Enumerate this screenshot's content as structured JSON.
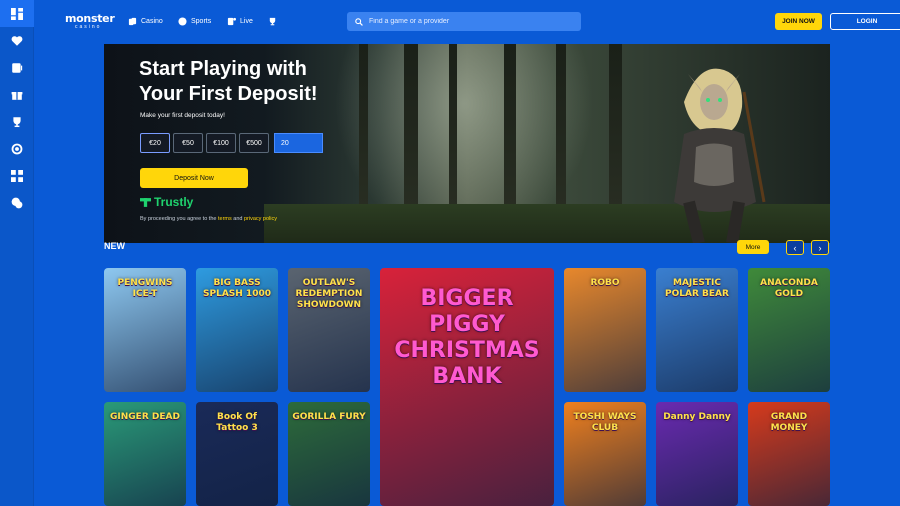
{
  "brand": {
    "logo_main": "monster",
    "logo_sub": "casino"
  },
  "nav": [
    {
      "label": "Casino",
      "icon": "cards-icon"
    },
    {
      "label": "Sports",
      "icon": "ball-icon"
    },
    {
      "label": "Live",
      "icon": "live-cards-icon"
    },
    {
      "label": "",
      "icon": "trophy-icon"
    }
  ],
  "search": {
    "placeholder": "Find a game or a provider",
    "value": ""
  },
  "auth": {
    "join": "JOIN NOW",
    "login": "LOGIN"
  },
  "sidebar": [
    {
      "icon": "dashboard-icon",
      "active": true
    },
    {
      "icon": "heart-icon"
    },
    {
      "icon": "slot-machine-icon"
    },
    {
      "icon": "gift-icon"
    },
    {
      "icon": "trophy-icon"
    },
    {
      "icon": "target-icon"
    },
    {
      "icon": "grid-icon"
    },
    {
      "icon": "chat-icon"
    }
  ],
  "hero": {
    "title_line1": "Start Playing with",
    "title_line2": "Your First Deposit!",
    "subtitle": "Make your first deposit today!",
    "amounts": [
      "€20",
      "€50",
      "€100",
      "€500"
    ],
    "amount_value": "20",
    "deposit_button": "Deposit Now",
    "trustly": "Trustly",
    "legal_prefix": "By proceeding you agree to the",
    "legal_terms": "terms",
    "legal_and": "and",
    "legal_privacy": "privacy policy"
  },
  "games_section": {
    "title": "NEW",
    "more": "More",
    "prev": "‹",
    "next": "›"
  },
  "games": [
    {
      "title": "PENGWINS ICE-T",
      "bg": "#8ec8f0"
    },
    {
      "title": "BIG BASS SPLASH 1000",
      "bg": "#2e9be0"
    },
    {
      "title": "OUTLAW'S REDEMPTION SHOWDOWN",
      "bg": "#5a6470"
    },
    {
      "title": "BIGGER PIGGY CHRISTMAS BANK",
      "bg": "#d8223a"
    },
    {
      "title": "ROBO",
      "bg": "#e8882c"
    },
    {
      "title": "MAJESTIC POLAR BEAR",
      "bg": "#3a7fd0"
    },
    {
      "title": "ANACONDA GOLD",
      "bg": "#3f8a3a"
    },
    {
      "title": "GINGER DEAD",
      "bg": "#2a9a78"
    },
    {
      "title": "Book Of Tattoo 3",
      "bg": "#1a2a58"
    },
    {
      "title": "GORILLA FURY",
      "bg": "#2d6b3a"
    },
    {
      "title": "TOSHI WAYS CLUB",
      "bg": "#f0801e"
    },
    {
      "title": "Danny Danny",
      "bg": "#6a2ab0"
    },
    {
      "title": "GRAND MONEY",
      "bg": "#d63a1c"
    }
  ]
}
